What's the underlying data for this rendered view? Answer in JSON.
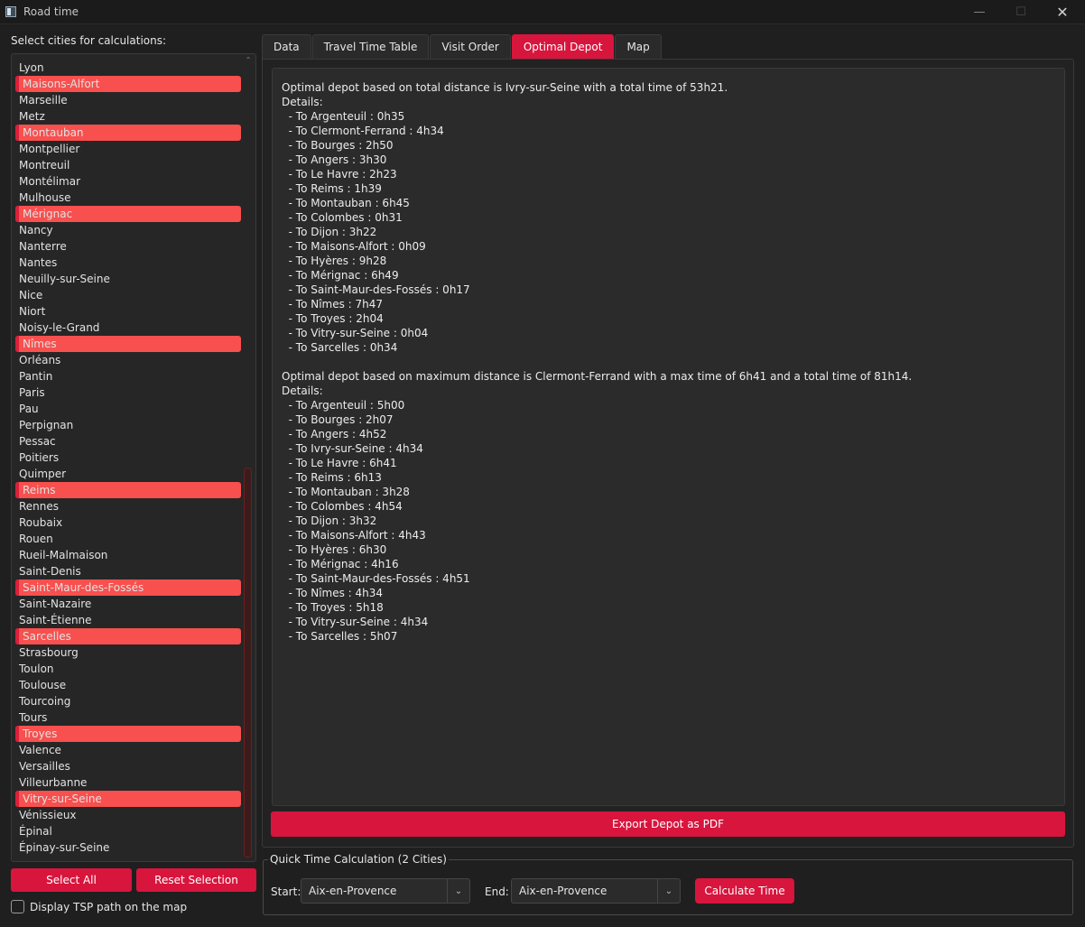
{
  "window": {
    "title": "Road time",
    "minimize_glyph": "—",
    "maximize_glyph": "☐",
    "close_glyph": "✕"
  },
  "sidebar": {
    "label": "Select cities for calculations:",
    "cities": [
      {
        "name": "Lyon",
        "selected": false
      },
      {
        "name": "Maisons-Alfort",
        "selected": true
      },
      {
        "name": "Marseille",
        "selected": false
      },
      {
        "name": "Metz",
        "selected": false
      },
      {
        "name": "Montauban",
        "selected": true
      },
      {
        "name": "Montpellier",
        "selected": false
      },
      {
        "name": "Montreuil",
        "selected": false
      },
      {
        "name": "Montélimar",
        "selected": false
      },
      {
        "name": "Mulhouse",
        "selected": false
      },
      {
        "name": "Mérignac",
        "selected": true
      },
      {
        "name": "Nancy",
        "selected": false
      },
      {
        "name": "Nanterre",
        "selected": false
      },
      {
        "name": "Nantes",
        "selected": false
      },
      {
        "name": "Neuilly-sur-Seine",
        "selected": false
      },
      {
        "name": "Nice",
        "selected": false
      },
      {
        "name": "Niort",
        "selected": false
      },
      {
        "name": "Noisy-le-Grand",
        "selected": false
      },
      {
        "name": "Nîmes",
        "selected": true
      },
      {
        "name": "Orléans",
        "selected": false
      },
      {
        "name": "Pantin",
        "selected": false
      },
      {
        "name": "Paris",
        "selected": false
      },
      {
        "name": "Pau",
        "selected": false
      },
      {
        "name": "Perpignan",
        "selected": false
      },
      {
        "name": "Pessac",
        "selected": false
      },
      {
        "name": "Poitiers",
        "selected": false
      },
      {
        "name": "Quimper",
        "selected": false
      },
      {
        "name": "Reims",
        "selected": true
      },
      {
        "name": "Rennes",
        "selected": false
      },
      {
        "name": "Roubaix",
        "selected": false
      },
      {
        "name": "Rouen",
        "selected": false
      },
      {
        "name": "Rueil-Malmaison",
        "selected": false
      },
      {
        "name": "Saint-Denis",
        "selected": false
      },
      {
        "name": "Saint-Maur-des-Fossés",
        "selected": true
      },
      {
        "name": "Saint-Nazaire",
        "selected": false
      },
      {
        "name": "Saint-Étienne",
        "selected": false
      },
      {
        "name": "Sarcelles",
        "selected": true
      },
      {
        "name": "Strasbourg",
        "selected": false
      },
      {
        "name": "Toulon",
        "selected": false
      },
      {
        "name": "Toulouse",
        "selected": false
      },
      {
        "name": "Tourcoing",
        "selected": false
      },
      {
        "name": "Tours",
        "selected": false
      },
      {
        "name": "Troyes",
        "selected": true
      },
      {
        "name": "Valence",
        "selected": false
      },
      {
        "name": "Versailles",
        "selected": false
      },
      {
        "name": "Villeurbanne",
        "selected": false
      },
      {
        "name": "Vitry-sur-Seine",
        "selected": true
      },
      {
        "name": "Vénissieux",
        "selected": false
      },
      {
        "name": "Épinal",
        "selected": false
      },
      {
        "name": "Épinay-sur-Seine",
        "selected": false
      }
    ],
    "select_all_label": "Select All",
    "reset_label": "Reset Selection",
    "tsp_label": "Display TSP path on the map",
    "tsp_checked": false
  },
  "tabs": [
    {
      "label": "Data",
      "active": false
    },
    {
      "label": "Travel Time Table",
      "active": false
    },
    {
      "label": "Visit Order",
      "active": false
    },
    {
      "label": "Optimal Depot",
      "active": true
    },
    {
      "label": "Map",
      "active": false
    }
  ],
  "depot": {
    "lines": [
      "Optimal depot based on total distance is Ivry-sur-Seine with a total time of 53h21.",
      "Details:",
      "  - To Argenteuil : 0h35",
      "  - To Clermont-Ferrand : 4h34",
      "  - To Bourges : 2h50",
      "  - To Angers : 3h30",
      "  - To Le Havre : 2h23",
      "  - To Reims : 1h39",
      "  - To Montauban : 6h45",
      "  - To Colombes : 0h31",
      "  - To Dijon : 3h22",
      "  - To Maisons-Alfort : 0h09",
      "  - To Hyères : 9h28",
      "  - To Mérignac : 6h49",
      "  - To Saint-Maur-des-Fossés : 0h17",
      "  - To Nîmes : 7h47",
      "  - To Troyes : 2h04",
      "  - To Vitry-sur-Seine : 0h04",
      "  - To Sarcelles : 0h34",
      "",
      "Optimal depot based on maximum distance is Clermont-Ferrand with a max time of 6h41 and a total time of 81h14.",
      "Details:",
      "  - To Argenteuil : 5h00",
      "  - To Bourges : 2h07",
      "  - To Angers : 4h52",
      "  - To Ivry-sur-Seine : 4h34",
      "  - To Le Havre : 6h41",
      "  - To Reims : 6h13",
      "  - To Montauban : 3h28",
      "  - To Colombes : 4h54",
      "  - To Dijon : 3h32",
      "  - To Maisons-Alfort : 4h43",
      "  - To Hyères : 6h30",
      "  - To Mérignac : 4h16",
      "  - To Saint-Maur-des-Fossés : 4h51",
      "  - To Nîmes : 4h34",
      "  - To Troyes : 5h18",
      "  - To Vitry-sur-Seine : 4h34",
      "  - To Sarcelles : 5h07"
    ],
    "export_label": "Export Depot as PDF"
  },
  "quick": {
    "title": "Quick Time Calculation (2 Cities)",
    "start_label": "Start:",
    "start_value": "Aix-en-Provence",
    "end_label": "End:",
    "end_value": "Aix-en-Provence",
    "calc_label": "Calculate Time",
    "dropdown_glyph": "⌄"
  },
  "colors": {
    "accent": "#d8153d",
    "selected_city": "#f7504e",
    "background": "#1f1f1f"
  }
}
